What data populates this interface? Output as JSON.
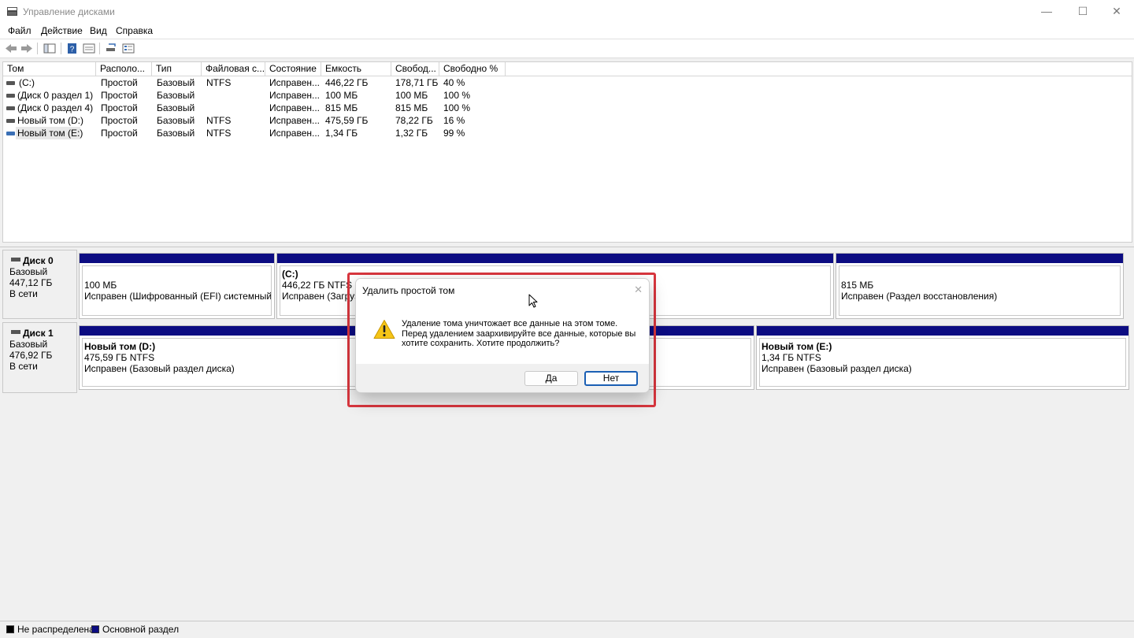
{
  "window": {
    "title": "Управление дисками",
    "controls": {
      "minimize": "—",
      "maximize": "☐",
      "close": "✕"
    }
  },
  "menu": [
    "Файл",
    "Действие",
    "Вид",
    "Справка"
  ],
  "toolbar_icons": [
    "back-icon",
    "forward-icon",
    "console-tree-icon",
    "help-icon",
    "properties-icon",
    "rescan-icon",
    "list-view-icon"
  ],
  "volume_list": {
    "columns": [
      "Том",
      "Располо...",
      "Тип",
      "Файловая с...",
      "Состояние",
      "Емкость",
      "Свобод...",
      "Свободно %"
    ],
    "rows": [
      [
        "(C:)",
        "Простой",
        "Базовый",
        "NTFS",
        "Исправен...",
        "446,22 ГБ",
        "178,71 ГБ",
        "40 %"
      ],
      [
        "(Диск 0 раздел 1)",
        "Простой",
        "Базовый",
        "",
        "Исправен...",
        "100 МБ",
        "100 МБ",
        "100 %"
      ],
      [
        "(Диск 0 раздел 4)",
        "Простой",
        "Базовый",
        "",
        "Исправен...",
        "815 МБ",
        "815 МБ",
        "100 %"
      ],
      [
        "Новый том (D:)",
        "Простой",
        "Базовый",
        "NTFS",
        "Исправен...",
        "475,59 ГБ",
        "78,22 ГБ",
        "16 %"
      ],
      [
        "Новый том (E:)",
        "Простой",
        "Базовый",
        "NTFS",
        "Исправен...",
        "1,34 ГБ",
        "1,32 ГБ",
        "99 %"
      ]
    ]
  },
  "disks": [
    {
      "name": "Диск 0",
      "type": "Базовый",
      "size": "447,12 ГБ",
      "status": "В сети",
      "partitions": [
        {
          "title": "",
          "size": "100 МБ",
          "status": "Исправен (Шифрованный (EFI) системный раз"
        },
        {
          "title": "(C:)",
          "size": "446,22 ГБ NTFS",
          "status": "Исправен (Загрузка"
        },
        {
          "title": "",
          "size": "815 МБ",
          "status": "Исправен (Раздел восстановления)"
        }
      ]
    },
    {
      "name": "Диск 1",
      "type": "Базовый",
      "size": "476,92 ГБ",
      "status": "В сети",
      "partitions": [
        {
          "title": "Новый том  (D:)",
          "size": "475,59 ГБ NTFS",
          "status": "Исправен (Базовый раздел диска)"
        },
        {
          "title": "Новый том  (E:)",
          "size": "1,34 ГБ NTFS",
          "status": "Исправен (Базовый раздел диска)"
        }
      ]
    }
  ],
  "legend": [
    {
      "label": "Не распределена",
      "color": "#000000"
    },
    {
      "label": "Основной раздел",
      "color": "#0c0c82"
    }
  ],
  "dialog": {
    "title": "Удалить простой том",
    "close": "✕",
    "message": "Удаление тома уничтожает все данные на этом томе. Перед удалением заархивируйте все данные, которые вы хотите сохранить. Хотите продолжить?",
    "yes_label": "Да",
    "no_label": "Нет",
    "icon": "warning-icon"
  },
  "colors": {
    "partition_bar": "#0c0c82",
    "highlight": "#d9363e",
    "default_button_border": "#1a5fb4"
  }
}
